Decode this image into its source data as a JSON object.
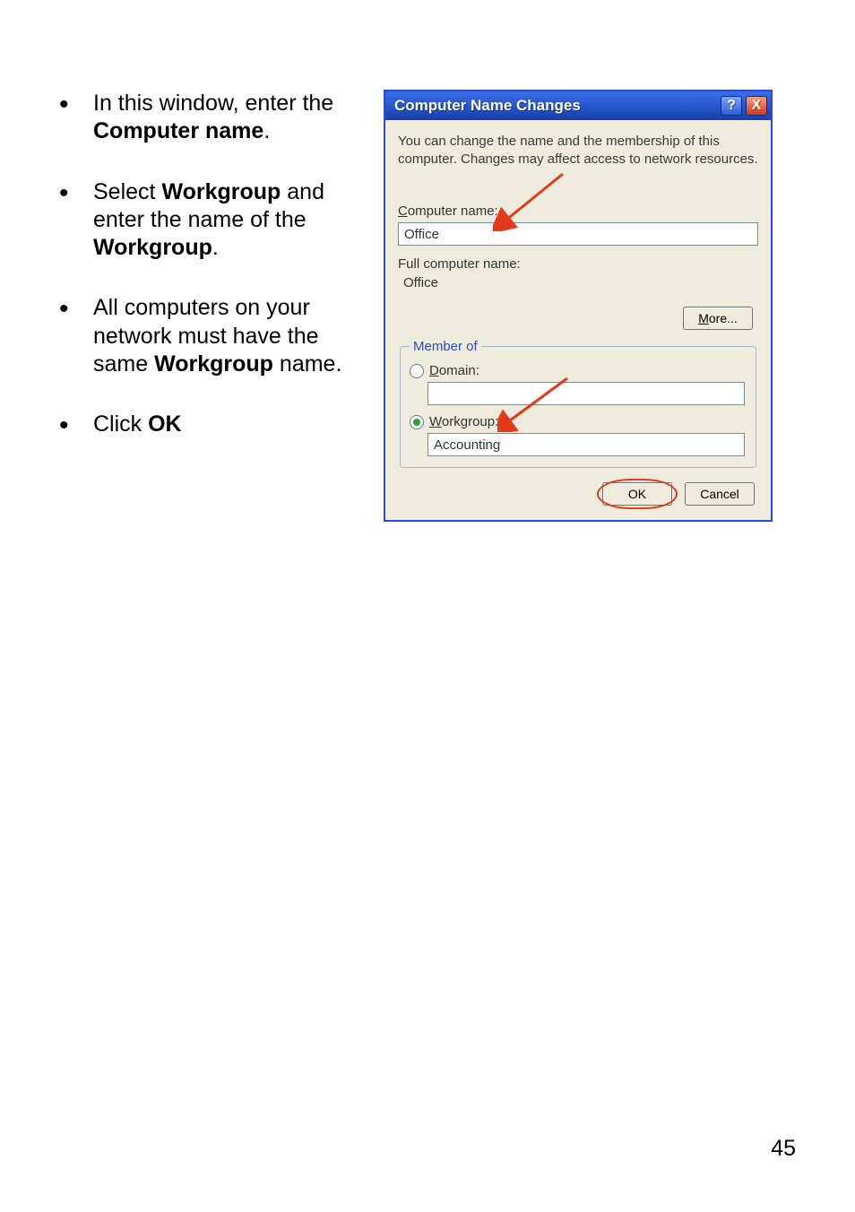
{
  "instructions": {
    "item1": {
      "pre": "In this window, enter the ",
      "bold1": "Computer name",
      "post1": "."
    },
    "item2": {
      "pre": "Select ",
      "bold1": "Workgroup",
      "mid": " and enter the name of the ",
      "bold2": "Workgroup",
      "post": "."
    },
    "item3": {
      "pre": "All computers on your network must have the same ",
      "bold1": "Workgroup",
      "post": " name."
    },
    "item4": {
      "pre": " Click ",
      "bold1": "OK"
    }
  },
  "dialog": {
    "title": "Computer Name Changes",
    "helpbtn_label": "?",
    "closebtn_label": "X",
    "description": "You can change the name and the membership of this computer. Changes may affect access to network resources.",
    "computer_name_label_pre": "C",
    "computer_name_label_rest": "omputer name:",
    "computer_name_value": "Office",
    "full_label": "Full computer name:",
    "full_value": "Office",
    "more_button_pre": "M",
    "more_button_rest": "ore...",
    "memberof_legend": "Member of",
    "domain_label_pre": "D",
    "domain_label_rest": "omain:",
    "domain_value": "",
    "workgroup_label_pre": "W",
    "workgroup_label_rest": "orkgroup:",
    "workgroup_value": "Accounting",
    "ok_label": "OK",
    "cancel_label": "Cancel"
  },
  "page_number": "45"
}
